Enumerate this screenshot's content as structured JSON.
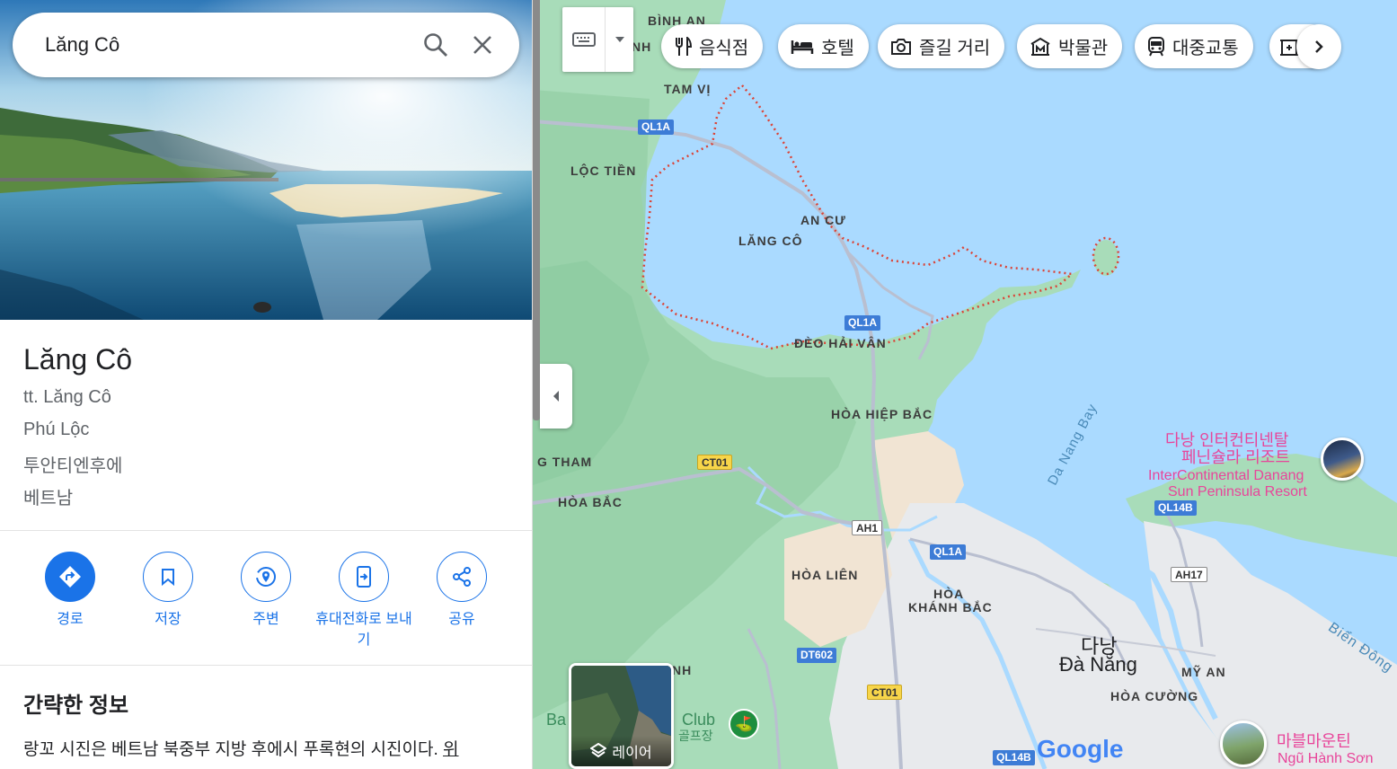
{
  "search": {
    "query": "Lăng Cô"
  },
  "place": {
    "title": "Lăng Cô",
    "address_lines": [
      "tt. Lăng Cô",
      "Phú Lộc",
      "투안티엔후에",
      "베트남"
    ]
  },
  "actions": [
    {
      "label": "경로",
      "icon": "directions-icon"
    },
    {
      "label": "저장",
      "icon": "bookmark-icon"
    },
    {
      "label": "주변",
      "icon": "nearby-icon"
    },
    {
      "label": "휴대전화로 보내기",
      "icon": "send-to-phone-icon"
    },
    {
      "label": "공유",
      "icon": "share-icon"
    }
  ],
  "summary": {
    "heading": "간략한 정보",
    "text": "랑꼬 시진은 베트남 북중부 지방 후에시 푸록현의 시진이다. ",
    "link": "위"
  },
  "chips": [
    {
      "label": "음식점",
      "icon": "restaurant-icon"
    },
    {
      "label": "호텔",
      "icon": "hotel-icon"
    },
    {
      "label": "즐길 거리",
      "icon": "camera-icon"
    },
    {
      "label": "박물관",
      "icon": "museum-icon"
    },
    {
      "label": "대중교통",
      "icon": "transit-icon"
    }
  ],
  "map": {
    "layers_label": "레이어",
    "labels": {
      "binh_an": "BÌNH AN",
      "tam_vi": "TAM VỊ",
      "loc_tien": "LỘC TIỀN",
      "an_cu": "AN CƯ",
      "lang_co": "LĂNG CÔ",
      "deo_hai_van": "ĐÈO HẢI VÂN",
      "hoa_hiep_bac": "HÒA HIỆP BẮC",
      "tham": "G THAM",
      "hoa_bac": "HÒA BẮC",
      "hoa_lien": "HÒA LIÊN",
      "hoa_khanh_bac_1": "HÒA",
      "hoa_khanh_bac_2": "KHÁNH BẮC",
      "my_an": "MỸ AN",
      "hoa_cuong": "HÒA CƯỜNG",
      "nh": "NH",
      "nh2": "NH",
      "da_nang_bay": "Da Nang Bay",
      "bien_dong": "Biển Đông",
      "da_nang_ko": "다낭",
      "da_nang_vi": "Đà Nẵng",
      "golf_ba": "Ba",
      "golf_club": "Club",
      "golf_ko": "골프장",
      "google": "Google"
    },
    "shields": {
      "ql1a_1": "QL1A",
      "ql1a_2": "QL1A",
      "ql1a_3": "QL1A",
      "ct01_1": "CT01",
      "ct01_2": "CT01",
      "ah1": "AH1",
      "ah17": "AH17",
      "dt602": "DT602",
      "ql14b_1": "QL14B",
      "ql14b_2": "QL14B"
    },
    "poi": {
      "intercontinental_ko_1": "다낭 인터컨티넨탈",
      "intercontinental_ko_2": "페닌슐라 리조트",
      "intercontinental_en_1": "InterContinental Danang",
      "intercontinental_en_2": "Sun Peninsula Resort",
      "marble_ko": "마블마운틴",
      "marble_vi": "Ngũ Hành Sơn"
    }
  },
  "colors": {
    "accent": "#1a73e8",
    "water": "#aadaff",
    "land": "#a8dcb9",
    "boundary": "#db4437",
    "poi": "#e8459a"
  }
}
